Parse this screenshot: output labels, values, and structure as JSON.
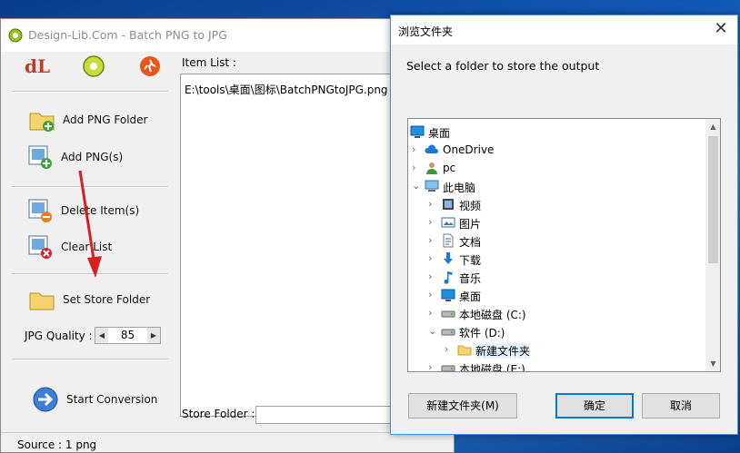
{
  "app": {
    "title": "Design-Lib.Com - Batch PNG to JPG",
    "toolbar": {
      "logo_text": "dL"
    },
    "buttons": {
      "add_folder": "Add PNG Folder",
      "add_png": "Add PNG(s)",
      "delete_item": "Delete Item(s)",
      "clear_list": "Clear List",
      "set_store": "Set Store Folder",
      "start": "Start Conversion"
    },
    "quality_label": "JPG Quality :",
    "quality_value": "85",
    "item_list_label": "Item List :",
    "items": [
      "E:\\tools\\桌面\\图标\\BatchPNGtoJPG.png"
    ],
    "store_folder_label": "Store Folder :",
    "store_folder_value": "",
    "status": "Source : 1  png"
  },
  "dialog": {
    "title": "浏览文件夹",
    "close": "✕",
    "prompt": "Select a folder to store the output",
    "tree": [
      {
        "label": "桌面",
        "icon": "desktop-icon",
        "level": 0,
        "chev": ""
      },
      {
        "label": "OneDrive",
        "icon": "cloud-icon",
        "level": 1,
        "chev": "›"
      },
      {
        "label": "pc",
        "icon": "user-icon",
        "level": 1,
        "chev": "›"
      },
      {
        "label": "此电脑",
        "icon": "computer-icon",
        "level": 1,
        "chev": "⌄"
      },
      {
        "label": "视频",
        "icon": "video-icon",
        "level": 2,
        "chev": "›"
      },
      {
        "label": "图片",
        "icon": "picture-icon",
        "level": 2,
        "chev": "›"
      },
      {
        "label": "文档",
        "icon": "document-icon",
        "level": 2,
        "chev": "›"
      },
      {
        "label": "下载",
        "icon": "download-icon",
        "level": 2,
        "chev": "›"
      },
      {
        "label": "音乐",
        "icon": "music-icon",
        "level": 2,
        "chev": "›"
      },
      {
        "label": "桌面",
        "icon": "desktop-icon",
        "level": 2,
        "chev": "›"
      },
      {
        "label": "本地磁盘 (C:)",
        "icon": "drive-icon",
        "level": 2,
        "chev": "›"
      },
      {
        "label": "软件 (D:)",
        "icon": "drive-icon",
        "level": 2,
        "chev": "⌄"
      },
      {
        "label": "新建文件夹",
        "icon": "folder-icon",
        "level": 3,
        "chev": "›",
        "selected": true
      },
      {
        "label": "本地磁盘 (E:)",
        "icon": "drive-icon",
        "level": 2,
        "chev": "›"
      }
    ],
    "buttons": {
      "new_folder": "新建文件夹(M)",
      "ok": "确定",
      "cancel": "取消"
    }
  },
  "colors": {
    "accent": "#0078d7",
    "arrow": "#d62020"
  }
}
